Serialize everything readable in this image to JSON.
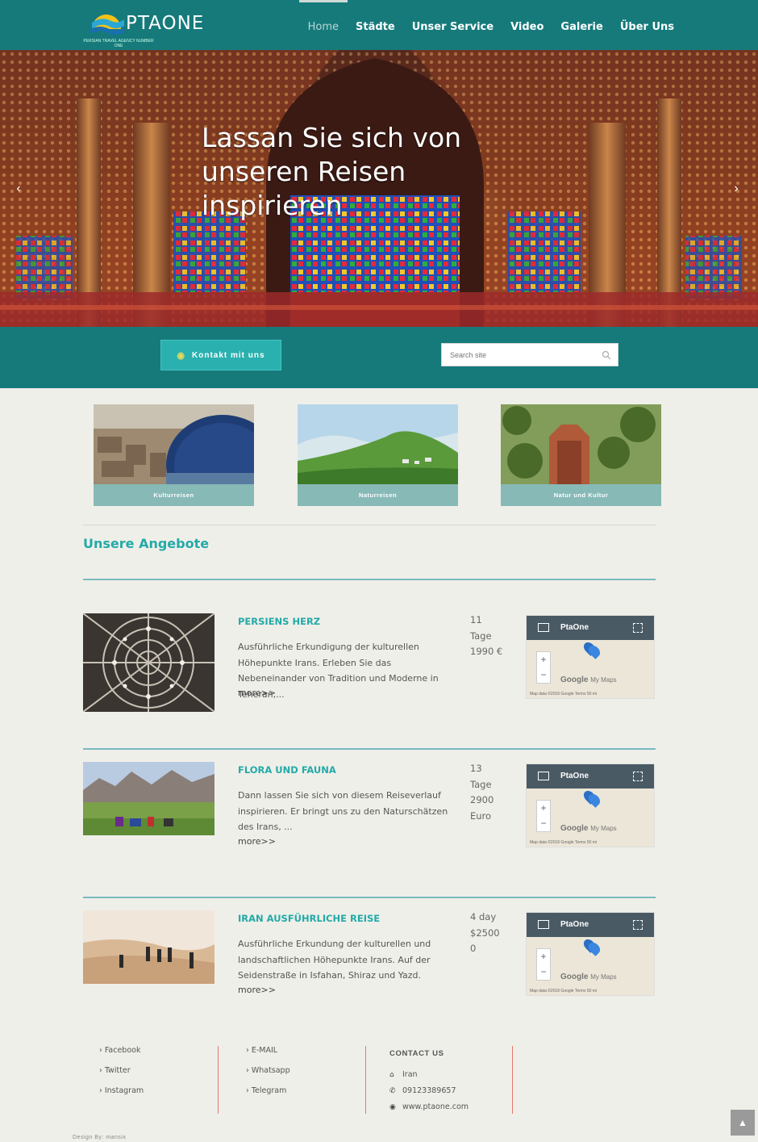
{
  "header": {
    "logo_text": "PTAONE",
    "logo_sub": "PERSIAN TRAVEL AGENCY NUMBER ONE",
    "nav": [
      {
        "label": "Home"
      },
      {
        "label": "Städte"
      },
      {
        "label": "Unser Service"
      },
      {
        "label": "Video"
      },
      {
        "label": "Galerie"
      },
      {
        "label": "Über Uns"
      }
    ]
  },
  "hero": {
    "title": "Lassan Sie sich von unseren Reisen inspirieren"
  },
  "actionbar": {
    "contact_label": "Kontakt mit uns",
    "search_placeholder": "Search site"
  },
  "categories": [
    {
      "label": "Kulturreisen"
    },
    {
      "label": "Naturreisen"
    },
    {
      "label": "Natur und Kultur"
    }
  ],
  "section_title": "Unsere Angebote",
  "offers": [
    {
      "title": "PERSIENS HERZ",
      "text": "Ausführliche Erkundigung der kulturellen Höhepunkte Irans. Erleben Sie das Nebeneinander von Tradition und Moderne in Teheran,...",
      "more": "more>>",
      "price_lines": [
        "11",
        "Tage",
        "1990 €"
      ],
      "map_title": "PtaOne"
    },
    {
      "title": "FLORA UND FAUNA",
      "text": "Dann lassen Sie sich von diesem Reiseverlauf inspirieren. Er bringt uns zu den Naturschätzen des Irans, ...",
      "more": "more>>",
      "price_lines": [
        "13",
        "Tage",
        "2900",
        "Euro"
      ],
      "map_title": "PtaOne"
    },
    {
      "title": "IRAN AUSFÜHRLICHE REISE",
      "text": "Ausführliche Erkundung der kulturellen und landschaftlichen Höhepunkte Irans. Auf der Seidenstraße in Isfahan, Shiraz und Yazd.",
      "more": "more>>",
      "price_lines": [
        "4 day",
        "$2500",
        "0"
      ],
      "map_title": "PtaOne"
    }
  ],
  "map_common": {
    "google_label": "Google",
    "mymaps_label": "My Maps",
    "footer_text": "Map data ©2019 Google   Terms   50 mi"
  },
  "footer": {
    "social": [
      "Facebook",
      "Twitter",
      "Instagram"
    ],
    "messaging": [
      "E-MAIL",
      "Whatsapp",
      "Telegram"
    ],
    "contact_heading": "CONTACT US",
    "contact": {
      "location": "Iran",
      "phone": "09123389657",
      "website": "www.ptaone.com"
    },
    "design_credit": "Design By: mansix"
  },
  "colors": {
    "teal_dark": "#167a7b",
    "teal_accent": "#23aaa8",
    "card_label_bg": "#87b9b7",
    "footer_divider": "#e47a6e"
  }
}
